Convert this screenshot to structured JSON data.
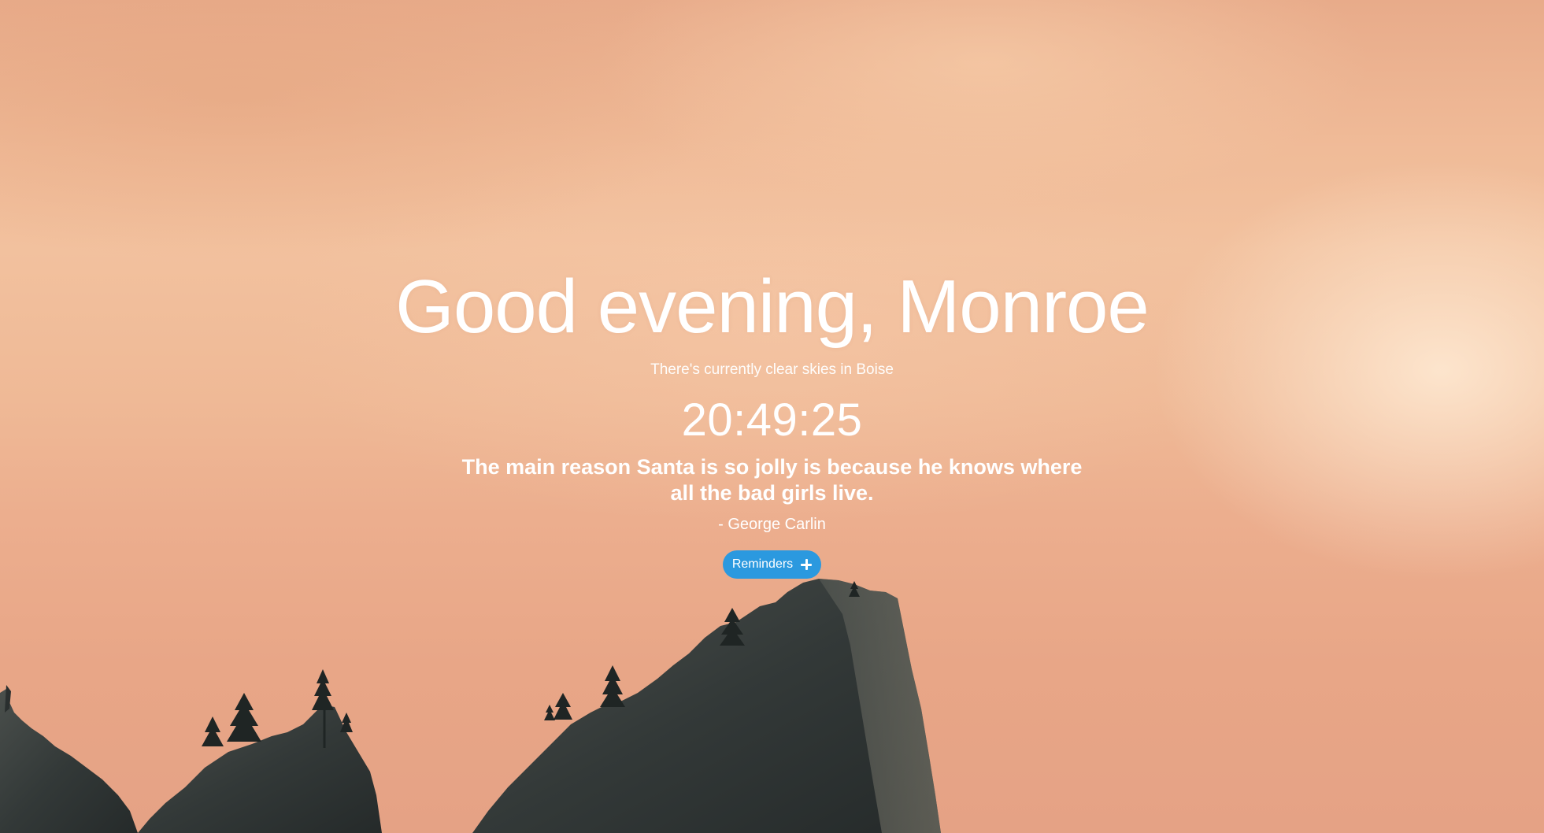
{
  "greeting": "Good evening, Monroe",
  "weather": "There's currently clear skies in Boise",
  "clock": "20:49:25",
  "quote": {
    "text": "The main reason Santa is so jolly is because he knows where all the bad girls live.",
    "author": "- George Carlin"
  },
  "reminders": {
    "label": "Reminders",
    "icon": "plus-icon",
    "color": "#2b99df"
  },
  "background": {
    "sky_color": "#efb996",
    "mountain_color": "#2f3535"
  }
}
